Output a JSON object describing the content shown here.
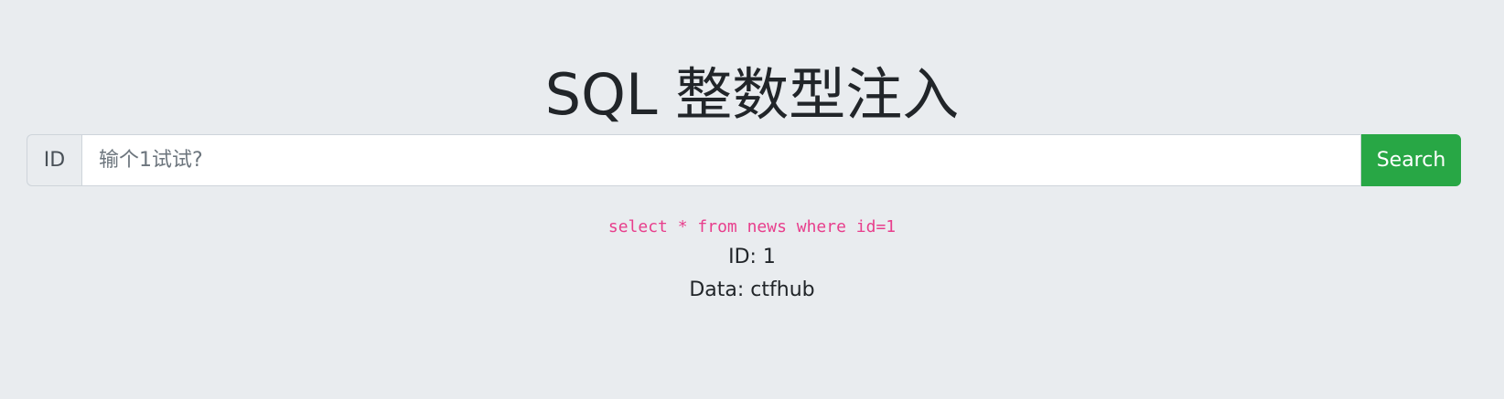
{
  "page": {
    "title": "SQL 整数型注入"
  },
  "search": {
    "prepend_label": "ID",
    "placeholder": "输个1试试?",
    "value": "",
    "button_label": "Search"
  },
  "result": {
    "query": "select * from news where id=1",
    "id_label": "ID:",
    "id_value": "1",
    "data_label": "Data:",
    "data_value": "ctfhub"
  },
  "colors": {
    "background": "#e9ecef",
    "button": "#28a745",
    "query_text": "#e83e8c"
  }
}
